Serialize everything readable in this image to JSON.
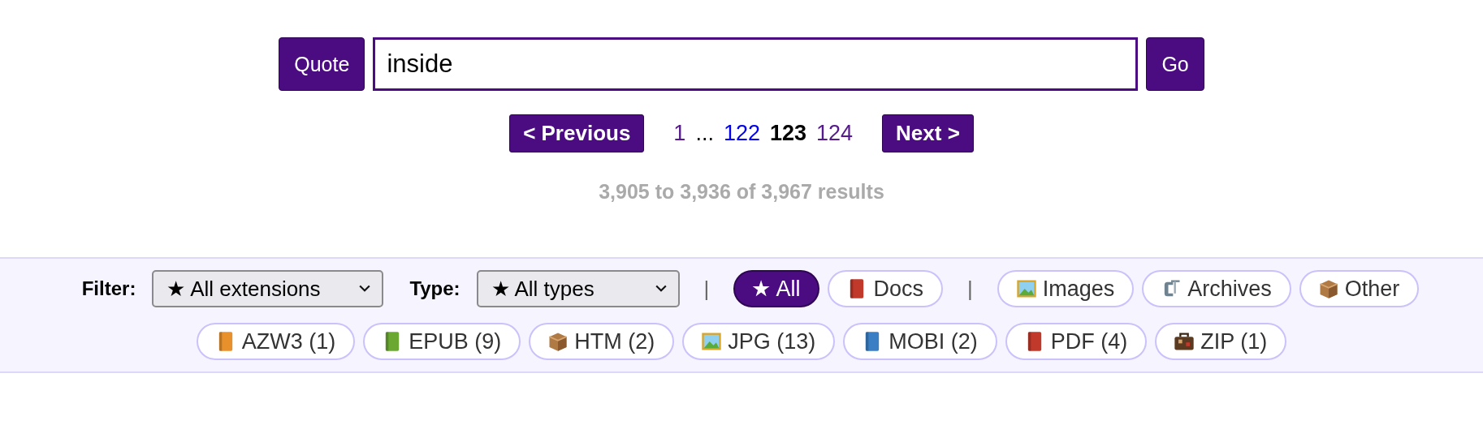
{
  "search": {
    "quote_button": "Quote",
    "value": "inside",
    "go_button": "Go"
  },
  "pagination": {
    "previous": "< Previous",
    "next": "Next >",
    "pages": [
      {
        "label": "1",
        "kind": "link",
        "visited": true,
        "selected": false
      },
      {
        "label": "...",
        "kind": "gap"
      },
      {
        "label": "122",
        "kind": "link",
        "visited": false,
        "selected": false
      },
      {
        "label": "123",
        "kind": "link",
        "visited": false,
        "selected": true
      },
      {
        "label": "124",
        "kind": "link",
        "visited": true,
        "selected": false
      }
    ]
  },
  "results": "3,905 to 3,936 of 3,967 results",
  "filters": {
    "filter_label": "Filter:",
    "extension_select": "★ All extensions",
    "type_label": "Type:",
    "type_select": "★ All types",
    "categories": [
      {
        "kind": "separator",
        "label": "|"
      },
      {
        "label": "★ All",
        "kind": "plain",
        "selected": true
      },
      {
        "label": "Docs",
        "kind": "book",
        "color": "#c0392b",
        "selected": false
      },
      {
        "kind": "separator",
        "label": "|"
      },
      {
        "label": "Images",
        "kind": "picture",
        "selected": false
      },
      {
        "label": "Archives",
        "kind": "clamp",
        "selected": false
      },
      {
        "label": "Other",
        "kind": "box",
        "selected": false
      }
    ],
    "extensions": [
      {
        "label": "AZW3 (1)",
        "kind": "book",
        "color": "#e8912c"
      },
      {
        "label": "EPUB (9)",
        "kind": "book",
        "color": "#6aa832"
      },
      {
        "label": "HTM (2)",
        "kind": "box"
      },
      {
        "label": "JPG (13)",
        "kind": "picture"
      },
      {
        "label": "MOBI (2)",
        "kind": "book",
        "color": "#3a7fc4"
      },
      {
        "label": "PDF (4)",
        "kind": "book",
        "color": "#c0392b"
      },
      {
        "label": "ZIP (1)",
        "kind": "suitcase"
      }
    ]
  }
}
